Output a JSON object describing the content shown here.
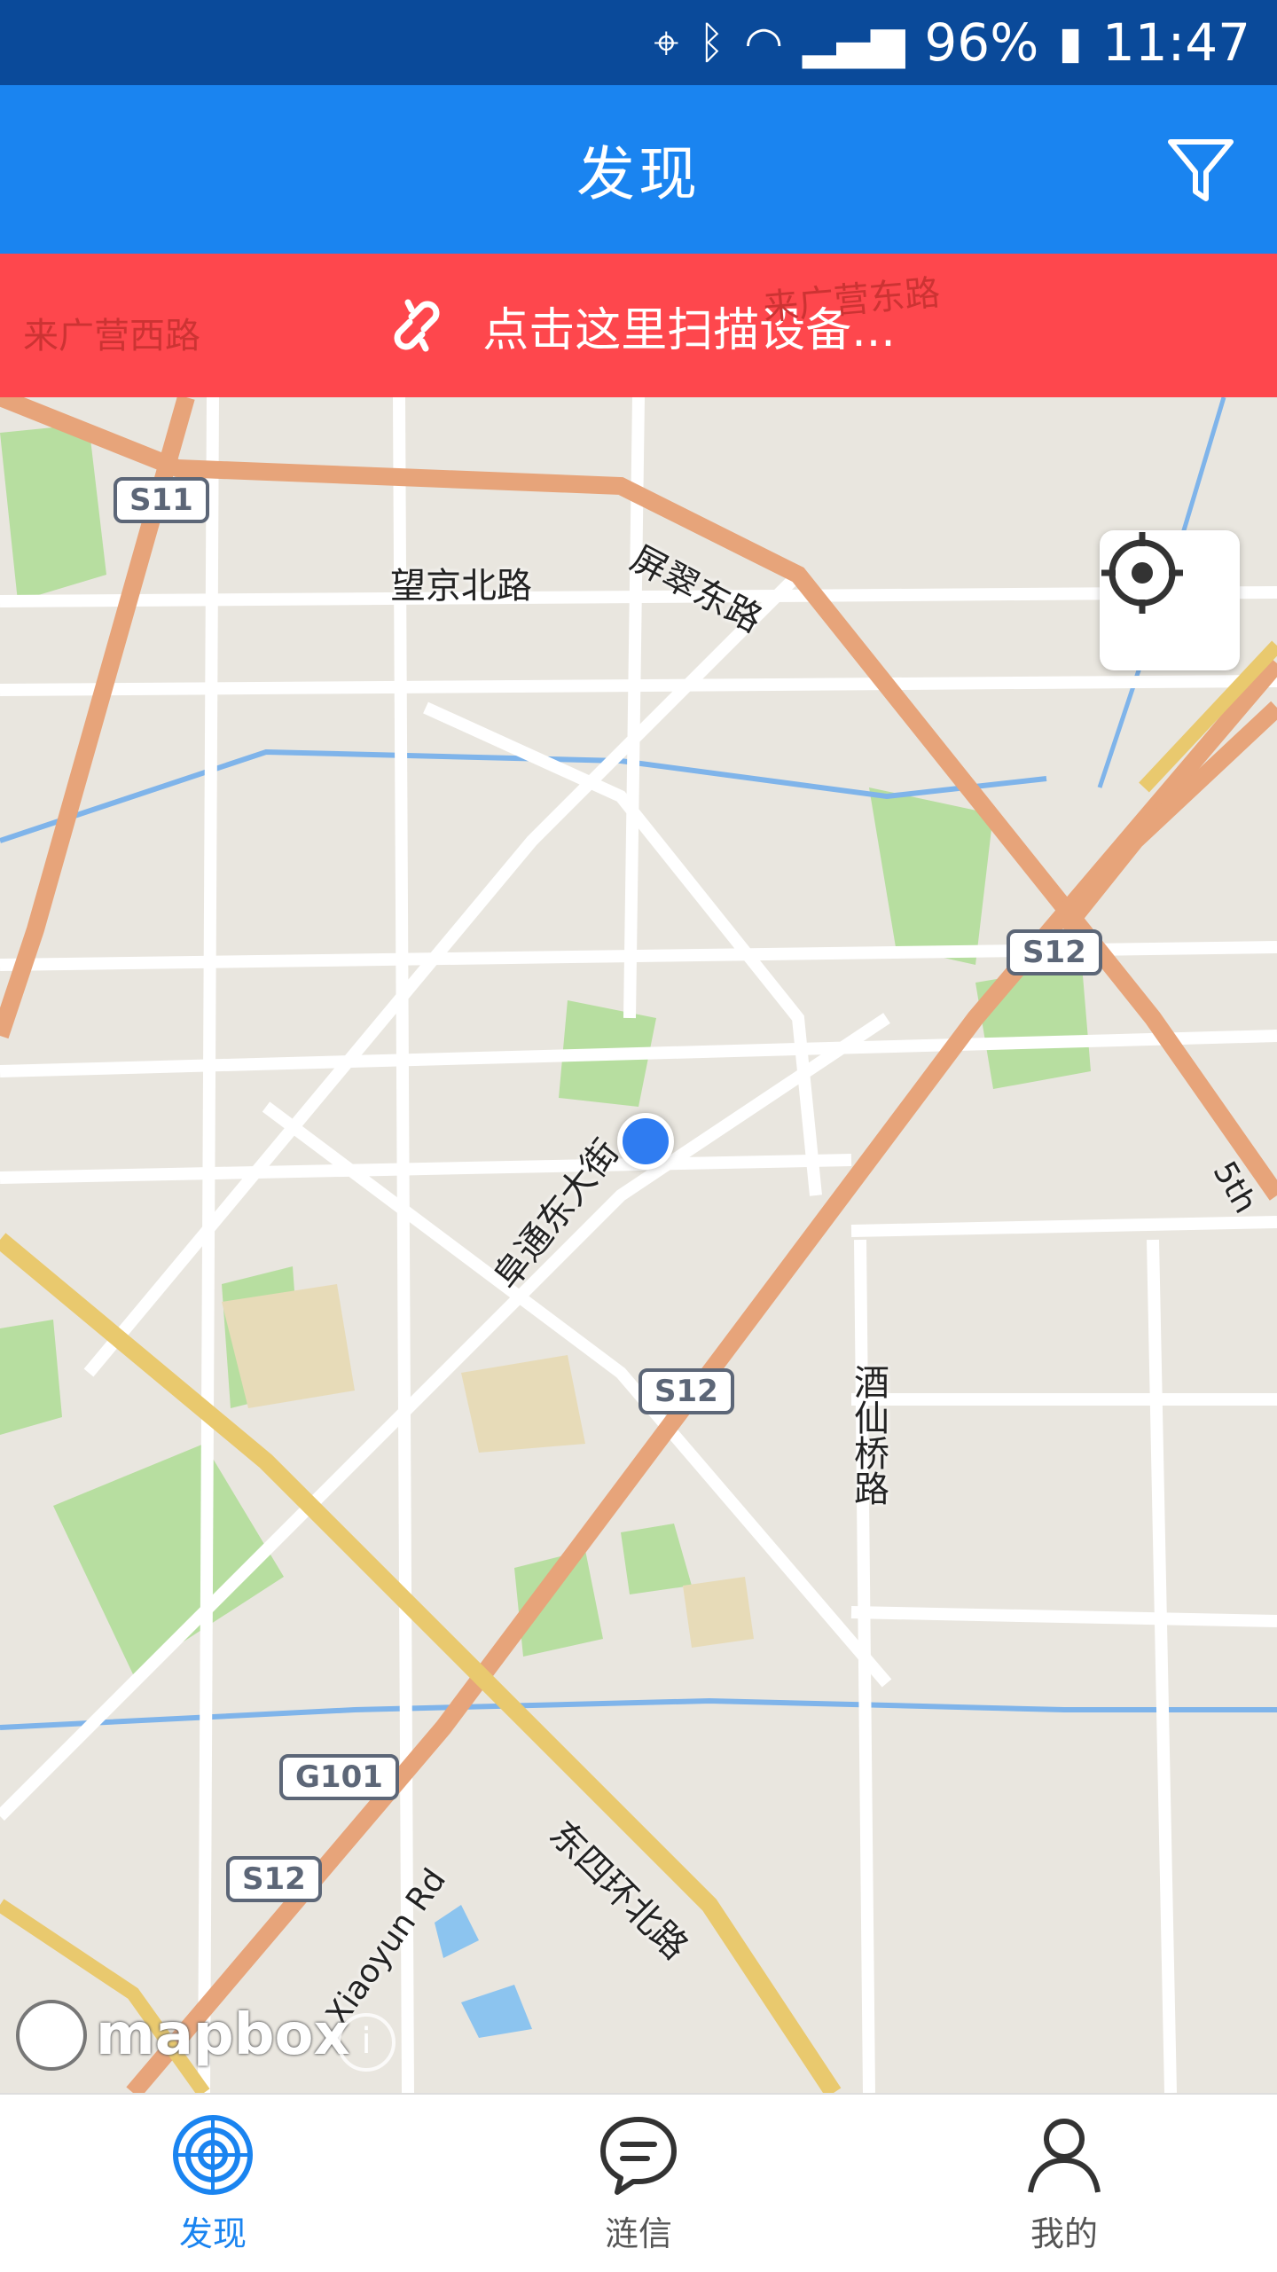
{
  "status_bar": {
    "battery": "96%",
    "time": "11:47"
  },
  "app_bar": {
    "title": "发现"
  },
  "scan_banner": {
    "text": "点击这里扫描设备..."
  },
  "map": {
    "labels": {
      "laiguangying_west": "来广营西路",
      "laiguangying_east": "来广营东路",
      "wangjing_north": "望京北路",
      "pingcui_east": "屏翠东路",
      "futong_east": "阜通东大街",
      "jiuxianqiao": "酒仙桥路",
      "east_4th_ring_north": "东四环北路",
      "xiaoyun": "Xiaoyun Rd",
      "fifth_ring": "5th"
    },
    "shields": {
      "s11": "S11",
      "s12_a": "S12",
      "s12_b": "S12",
      "s12_c": "S12",
      "g101": "G101"
    },
    "attribution": "mapbox"
  },
  "bottom_nav": {
    "items": [
      {
        "label": "发现"
      },
      {
        "label": "涟信"
      },
      {
        "label": "我的"
      }
    ]
  }
}
